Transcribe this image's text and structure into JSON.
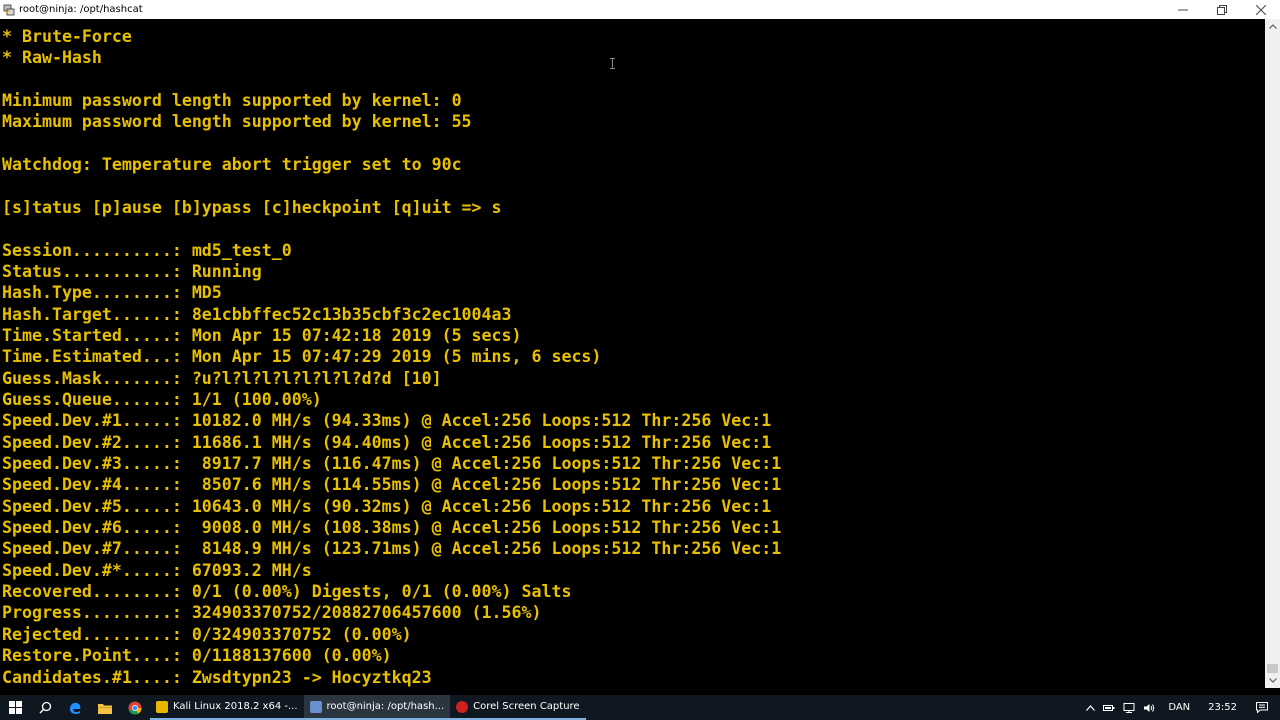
{
  "window": {
    "title": "root@ninja: /opt/hashcat"
  },
  "terminal": {
    "lines": [
      "* Brute-Force",
      "* Raw-Hash",
      "",
      "Minimum password length supported by kernel: 0",
      "Maximum password length supported by kernel: 55",
      "",
      "Watchdog: Temperature abort trigger set to 90c",
      "",
      "[s]tatus [p]ause [b]ypass [c]heckpoint [q]uit => s",
      "",
      "Session..........: md5_test_0",
      "Status...........: Running",
      "Hash.Type........: MD5",
      "Hash.Target......: 8e1cbbffec52c13b35cbf3c2ec1004a3",
      "Time.Started.....: Mon Apr 15 07:42:18 2019 (5 secs)",
      "Time.Estimated...: Mon Apr 15 07:47:29 2019 (5 mins, 6 secs)",
      "Guess.Mask.......: ?u?l?l?l?l?l?l?l?d?d [10]",
      "Guess.Queue......: 1/1 (100.00%)",
      "Speed.Dev.#1.....: 10182.0 MH/s (94.33ms) @ Accel:256 Loops:512 Thr:256 Vec:1",
      "Speed.Dev.#2.....: 11686.1 MH/s (94.40ms) @ Accel:256 Loops:512 Thr:256 Vec:1",
      "Speed.Dev.#3.....:  8917.7 MH/s (116.47ms) @ Accel:256 Loops:512 Thr:256 Vec:1",
      "Speed.Dev.#4.....:  8507.6 MH/s (114.55ms) @ Accel:256 Loops:512 Thr:256 Vec:1",
      "Speed.Dev.#5.....: 10643.0 MH/s (90.32ms) @ Accel:256 Loops:512 Thr:256 Vec:1",
      "Speed.Dev.#6.....:  9008.0 MH/s (108.38ms) @ Accel:256 Loops:512 Thr:256 Vec:1",
      "Speed.Dev.#7.....:  8148.9 MH/s (123.71ms) @ Accel:256 Loops:512 Thr:256 Vec:1",
      "Speed.Dev.#*.....: 67093.2 MH/s",
      "Recovered........: 0/1 (0.00%) Digests, 0/1 (0.00%) Salts",
      "Progress.........: 324903370752/20882706457600 (1.56%)",
      "Rejected.........: 0/324903370752 (0.00%)",
      "Restore.Point....: 0/1188137600 (0.00%)",
      "Candidates.#1....: Zwsdtypn23 -> Hocyztkq23"
    ],
    "text_color": "#e8c000",
    "background": "#000000"
  },
  "taskbar": {
    "apps": [
      {
        "label": "Kali Linux 2018.2 x64 -...",
        "icon": "vmware-icon",
        "color": "#e8b600"
      },
      {
        "label": "root@ninja: /opt/hash...",
        "icon": "putty-icon",
        "color": "#6a8fd0"
      },
      {
        "label": "Corel Screen Capture",
        "icon": "corel-icon",
        "color": "#d02020"
      }
    ],
    "tray": {
      "language": "DAN",
      "time": "23:52"
    }
  }
}
